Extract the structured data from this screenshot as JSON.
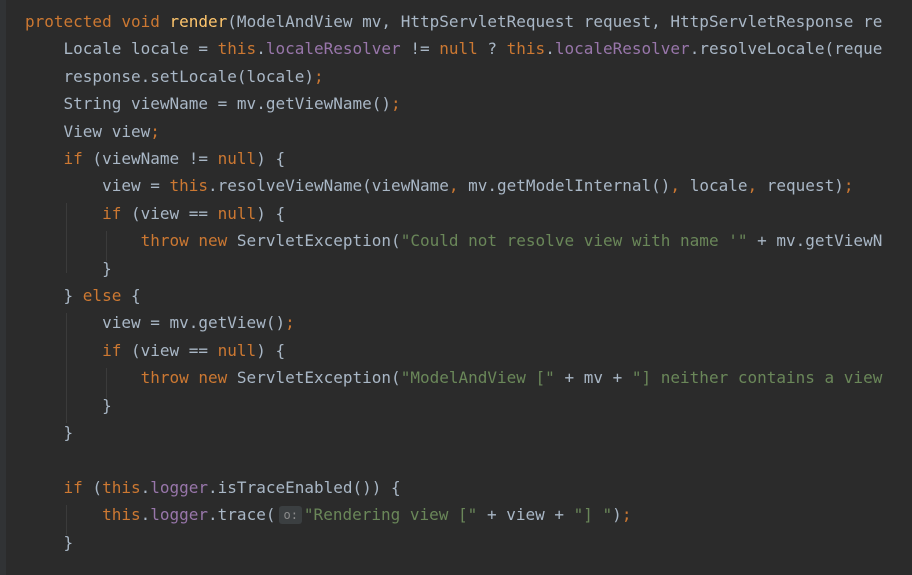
{
  "editor": {
    "lines": [
      [
        [
          "kw",
          "protected void "
        ],
        [
          "fn",
          "render"
        ],
        [
          "pl",
          "(ModelAndView mv, HttpServletRequest request, HttpServletResponse re"
        ]
      ],
      [
        [
          "pl",
          "    Locale locale = "
        ],
        [
          "kw",
          "this"
        ],
        [
          "pl",
          "."
        ],
        [
          "fld",
          "localeResolver"
        ],
        [
          "pl",
          " != "
        ],
        [
          "kw",
          "null"
        ],
        [
          "pl",
          " ? "
        ],
        [
          "kw",
          "this"
        ],
        [
          "pl",
          "."
        ],
        [
          "fld",
          "localeResolver"
        ],
        [
          "pl",
          ".resolveLocale(reque"
        ]
      ],
      [
        [
          "pl",
          "    response.setLocale(locale)"
        ],
        [
          "kw",
          ";"
        ]
      ],
      [
        [
          "pl",
          "    String viewName = mv.getViewName()"
        ],
        [
          "kw",
          ";"
        ]
      ],
      [
        [
          "pl",
          "    View view"
        ],
        [
          "kw",
          ";"
        ]
      ],
      [
        [
          "pl",
          "    "
        ],
        [
          "kw",
          "if"
        ],
        [
          "pl",
          " (viewName != "
        ],
        [
          "kw",
          "null"
        ],
        [
          "pl",
          ") {"
        ]
      ],
      [
        [
          "pl",
          "        view = "
        ],
        [
          "kw",
          "this"
        ],
        [
          "pl",
          ".resolveViewName(viewName"
        ],
        [
          "kw",
          ","
        ],
        [
          "pl",
          " mv.getModelInternal()"
        ],
        [
          "kw",
          ","
        ],
        [
          "pl",
          " locale"
        ],
        [
          "kw",
          ","
        ],
        [
          "pl",
          " request)"
        ],
        [
          "kw",
          ";"
        ]
      ],
      [
        [
          "pl",
          "        "
        ],
        [
          "kw",
          "if"
        ],
        [
          "pl",
          " (view == "
        ],
        [
          "kw",
          "null"
        ],
        [
          "pl",
          ") {"
        ]
      ],
      [
        [
          "pl",
          "            "
        ],
        [
          "kw",
          "throw new "
        ],
        [
          "pl",
          "ServletException("
        ],
        [
          "str",
          "\"Could not resolve view with name '\""
        ],
        [
          "pl",
          " + mv.getViewN"
        ]
      ],
      [
        [
          "pl",
          "        }"
        ]
      ],
      [
        [
          "pl",
          "    } "
        ],
        [
          "kw",
          "else"
        ],
        [
          "pl",
          " {"
        ]
      ],
      [
        [
          "pl",
          "        view = mv.getView()"
        ],
        [
          "kw",
          ";"
        ]
      ],
      [
        [
          "pl",
          "        "
        ],
        [
          "kw",
          "if"
        ],
        [
          "pl",
          " (view == "
        ],
        [
          "kw",
          "null"
        ],
        [
          "pl",
          ") {"
        ]
      ],
      [
        [
          "pl",
          "            "
        ],
        [
          "kw",
          "throw new "
        ],
        [
          "pl",
          "ServletException("
        ],
        [
          "str",
          "\"ModelAndView [\""
        ],
        [
          "pl",
          " + mv + "
        ],
        [
          "str",
          "\"] neither contains a view"
        ]
      ],
      [
        [
          "pl",
          "        }"
        ]
      ],
      [
        [
          "pl",
          "    }"
        ]
      ],
      [],
      [
        [
          "pl",
          "    "
        ],
        [
          "kw",
          "if"
        ],
        [
          "pl",
          " ("
        ],
        [
          "kw",
          "this"
        ],
        [
          "pl",
          "."
        ],
        [
          "fld",
          "logger"
        ],
        [
          "pl",
          ".isTraceEnabled()) {"
        ]
      ],
      [
        [
          "pl",
          "        "
        ],
        [
          "kw",
          "this"
        ],
        [
          "pl",
          "."
        ],
        [
          "fld",
          "logger"
        ],
        [
          "pl",
          ".trace("
        ],
        [
          "hint",
          "o:"
        ],
        [
          "str",
          "\"Rendering view [\""
        ],
        [
          "pl",
          " + view + "
        ],
        [
          "str",
          "\"] \""
        ],
        [
          "pl",
          ")"
        ],
        [
          "kw",
          ";"
        ]
      ],
      [
        [
          "pl",
          "    }"
        ]
      ]
    ]
  }
}
